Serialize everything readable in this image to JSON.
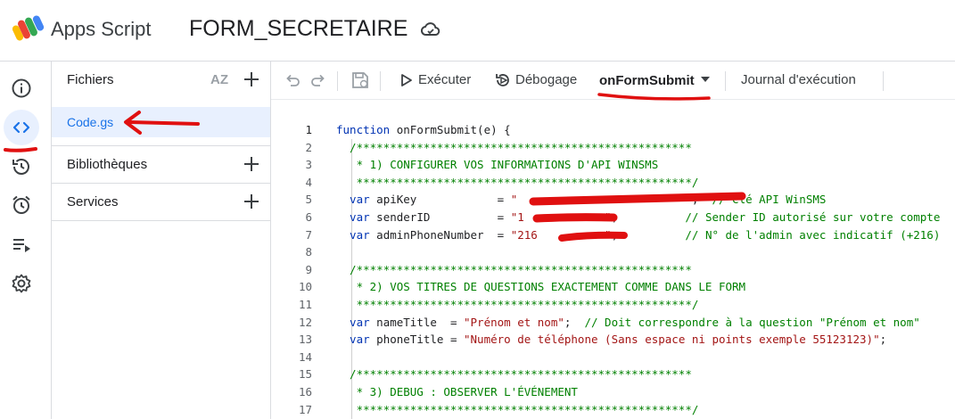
{
  "header": {
    "app_name": "Apps Script",
    "project_name": "FORM_SECRETAIRE"
  },
  "rail": {
    "items": [
      {
        "icon": "info-icon"
      },
      {
        "icon": "code-icon",
        "active": true
      },
      {
        "icon": "history-icon"
      },
      {
        "icon": "alarm-clock-icon"
      },
      {
        "icon": "executions-icon"
      },
      {
        "icon": "settings-gear-icon"
      }
    ]
  },
  "files_panel": {
    "title": "Fichiers",
    "sort_label": "AZ",
    "files": [
      {
        "name": "Code.gs",
        "selected": true
      }
    ],
    "libraries_label": "Bibliothèques",
    "services_label": "Services"
  },
  "toolbar": {
    "run_label": "Exécuter",
    "debug_label": "Débogage",
    "function_name": "onFormSubmit",
    "log_label": "Journal d'exécution"
  },
  "editor": {
    "lines": [
      {
        "n": "1",
        "segments": [
          {
            "t": "function",
            "c": "kw"
          },
          {
            "t": " onFormSubmit(e) {",
            "c": "plain"
          }
        ]
      },
      {
        "n": "2",
        "segments": [
          {
            "t": "  /**************************************************",
            "c": "cm"
          }
        ]
      },
      {
        "n": "3",
        "segments": [
          {
            "t": "   * 1) CONFIGURER VOS INFORMATIONS D'API WINSMS",
            "c": "cm"
          }
        ]
      },
      {
        "n": "4",
        "segments": [
          {
            "t": "   **************************************************/",
            "c": "cm"
          }
        ]
      },
      {
        "n": "5",
        "segments": [
          {
            "t": "  var",
            "c": "kw"
          },
          {
            "t": " apiKey            = ",
            "c": "plain"
          },
          {
            "t": "\"                         \"",
            "c": "str"
          },
          {
            "t": ";  ",
            "c": "plain"
          },
          {
            "t": "// Clé API WinSMS",
            "c": "cm"
          }
        ]
      },
      {
        "n": "6",
        "segments": [
          {
            "t": "  var",
            "c": "kw"
          },
          {
            "t": " senderID          = ",
            "c": "plain"
          },
          {
            "t": "\"1            \"",
            "c": "str"
          },
          {
            "t": ";          ",
            "c": "plain"
          },
          {
            "t": "// Sender ID autorisé sur votre compte",
            "c": "cm"
          }
        ]
      },
      {
        "n": "7",
        "segments": [
          {
            "t": "  var",
            "c": "kw"
          },
          {
            "t": " adminPhoneNumber  = ",
            "c": "plain"
          },
          {
            "t": "\"216          \"",
            "c": "str"
          },
          {
            "t": ";          ",
            "c": "plain"
          },
          {
            "t": "// N° de l'admin avec indicatif (+216)",
            "c": "cm"
          }
        ]
      },
      {
        "n": "8",
        "segments": []
      },
      {
        "n": "9",
        "segments": [
          {
            "t": "  /**************************************************",
            "c": "cm"
          }
        ]
      },
      {
        "n": "10",
        "segments": [
          {
            "t": "   * 2) VOS TITRES DE QUESTIONS EXACTEMENT COMME DANS LE FORM",
            "c": "cm"
          }
        ]
      },
      {
        "n": "11",
        "segments": [
          {
            "t": "   **************************************************/",
            "c": "cm"
          }
        ]
      },
      {
        "n": "12",
        "segments": [
          {
            "t": "  var",
            "c": "kw"
          },
          {
            "t": " nameTitle  = ",
            "c": "plain"
          },
          {
            "t": "\"Prénom et nom\"",
            "c": "str"
          },
          {
            "t": ";  ",
            "c": "plain"
          },
          {
            "t": "// Doit correspondre à la question \"Prénom et nom\"",
            "c": "cm"
          }
        ]
      },
      {
        "n": "13",
        "segments": [
          {
            "t": "  var",
            "c": "kw"
          },
          {
            "t": " phoneTitle = ",
            "c": "plain"
          },
          {
            "t": "\"Numéro de téléphone (Sans espace ni points exemple 55123123)\"",
            "c": "str"
          },
          {
            "t": ";",
            "c": "plain"
          }
        ]
      },
      {
        "n": "14",
        "segments": []
      },
      {
        "n": "15",
        "segments": [
          {
            "t": "  /**************************************************",
            "c": "cm"
          }
        ]
      },
      {
        "n": "16",
        "segments": [
          {
            "t": "   * 3) DEBUG : OBSERVER L'ÉVÉNEMENT",
            "c": "cm"
          }
        ]
      },
      {
        "n": "17",
        "segments": [
          {
            "t": "   **************************************************/",
            "c": "cm"
          }
        ]
      }
    ]
  },
  "colors": {
    "accent": "#1a73e8",
    "selected_bg": "#e8f0fe",
    "annotation": "#e01010",
    "keyword": "#0033b3",
    "comment": "#008000",
    "string": "#a31515"
  }
}
